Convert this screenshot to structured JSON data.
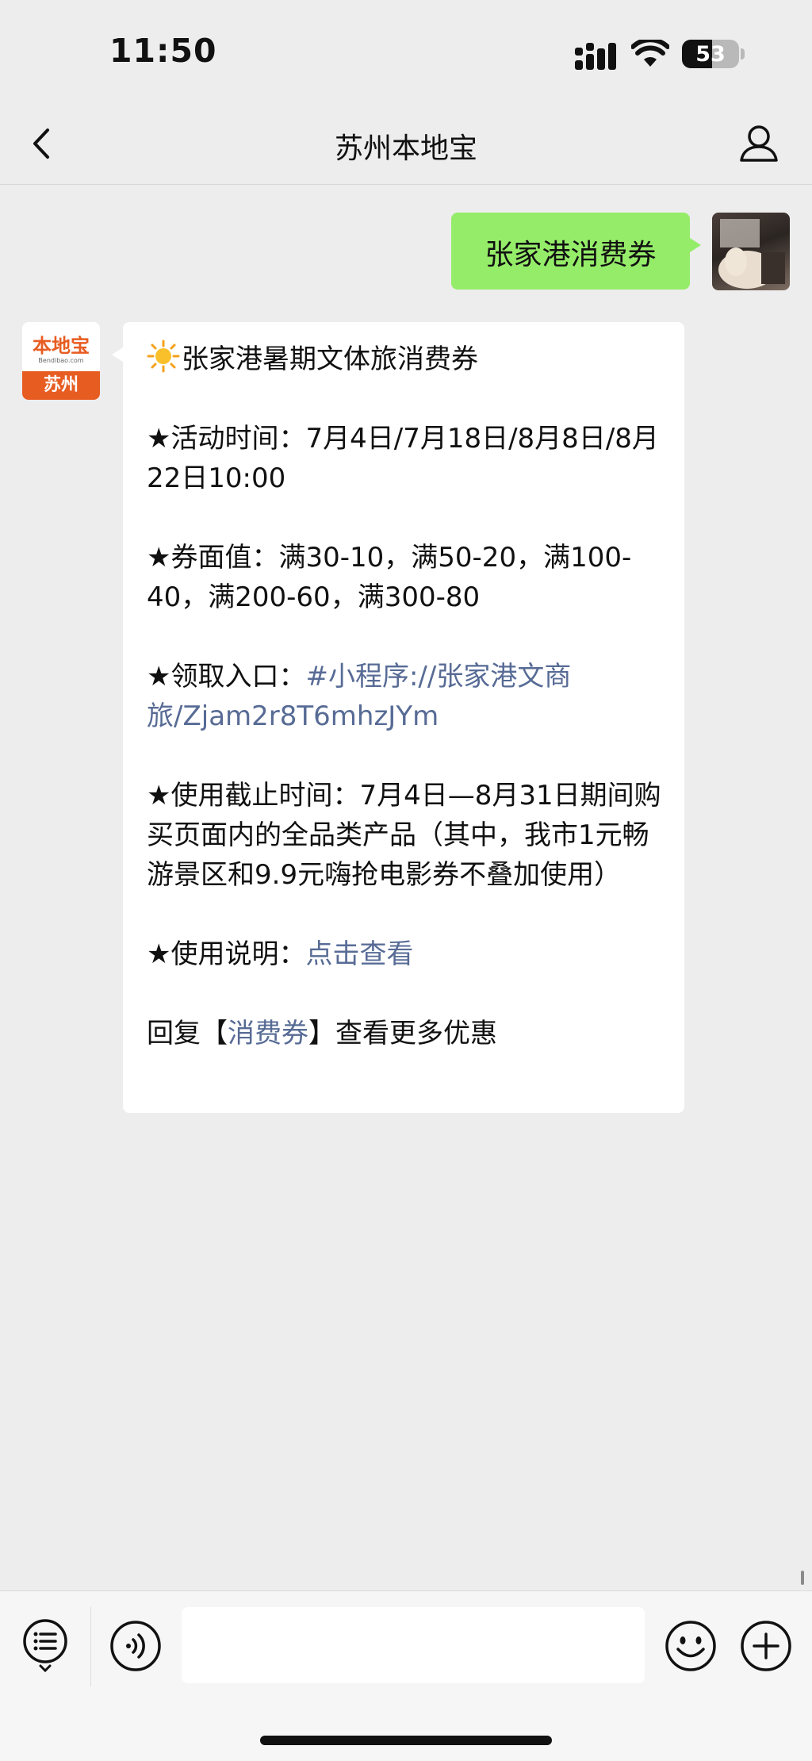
{
  "status_bar": {
    "time": "11:50",
    "battery_level": "53"
  },
  "nav": {
    "title": "苏州本地宝"
  },
  "outgoing_message": {
    "text": "张家港消费券"
  },
  "bot_avatar": {
    "logo_text": "本地宝",
    "logo_sub": "Bendibao.com",
    "city": "苏州"
  },
  "incoming_message": {
    "title": "张家港暑期文体旅消费券",
    "activity_time": "★活动时间：7月4日/7月18日/8月8日/8月22日10:00",
    "face_value": "★券面值：满30-10，满50-20，满100-40，满200-60，满300-80",
    "entry_label": "★领取入口：",
    "entry_link": "#小程序://张家港文商旅/Zjam2r8T6mhzJYm",
    "deadline": "★使用截止时间：7月4日—8月31日期间购买页面内的全品类产品（其中，我市1元畅游景区和9.9元嗨抢电影券不叠加使用）",
    "usage_label": "★使用说明：",
    "usage_link": "点击查看",
    "reply_prefix": "回复【",
    "reply_link": "消费券",
    "reply_suffix": "】查看更多优惠"
  },
  "input_bar": {
    "placeholder": ""
  },
  "colors": {
    "outgoing_bubble": "#95ec69",
    "link": "#576b95",
    "background": "#ededed",
    "brand_orange": "#e75c21"
  },
  "icons": [
    "back-arrow-icon",
    "person-icon",
    "menu-list-icon",
    "voice-icon",
    "emoji-icon",
    "plus-icon",
    "sun-icon",
    "signal-icon",
    "wifi-icon",
    "battery-icon"
  ]
}
